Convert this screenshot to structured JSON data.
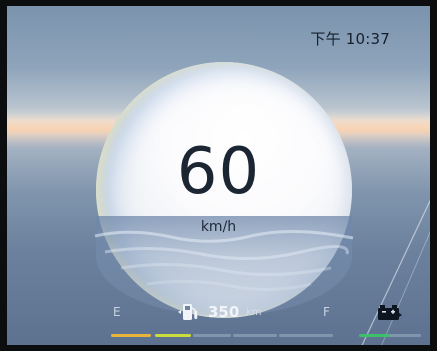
{
  "status": {
    "time": "下午 10:37"
  },
  "speedometer": {
    "value": "60",
    "unit": "km/h"
  },
  "fuel": {
    "empty_label": "E",
    "full_label": "F",
    "range_value": "350",
    "range_unit": "km",
    "icon": "fuel-pump-icon",
    "level_segments": [
      {
        "color": "#e9b43a"
      },
      {
        "color": "#c9dd3c"
      },
      {
        "color": "#8096ae"
      },
      {
        "color": "#8096ae"
      },
      {
        "color": "#8096ae"
      }
    ]
  },
  "battery": {
    "icon": "battery-icon",
    "indicator_color": "#3ec06a"
  },
  "colors": {
    "text_dark": "#1c2633",
    "fuel_low": "#e9b43a",
    "fuel_mid": "#c9dd3c",
    "battery_ok": "#3ec06a"
  }
}
